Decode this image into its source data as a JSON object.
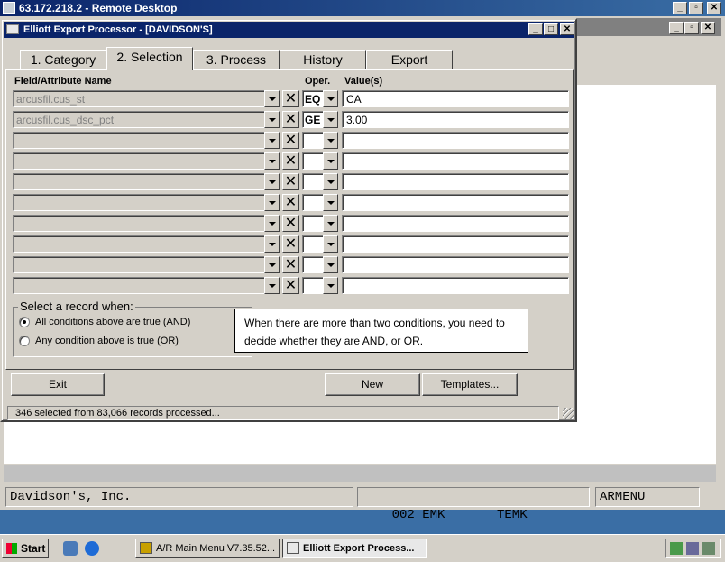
{
  "remote_desktop": {
    "title": "63.172.218.2 - Remote Desktop"
  },
  "dialog": {
    "title": "Elliott Export Processor - [DAVIDSON'S]",
    "tabs": [
      {
        "label": "1. Category"
      },
      {
        "label": "2. Selection"
      },
      {
        "label": "3. Process"
      },
      {
        "label": "History"
      },
      {
        "label": "Export"
      }
    ],
    "headers": {
      "field": "Field/Attribute Name",
      "oper": "Oper.",
      "value": "Value(s)"
    },
    "rows": [
      {
        "field": "arcusfil.cus_st",
        "oper": "EQ",
        "value": "CA"
      },
      {
        "field": "arcusfil.cus_dsc_pct",
        "oper": "GE",
        "value": "3.00"
      },
      {
        "field": "",
        "oper": "",
        "value": ""
      },
      {
        "field": "",
        "oper": "",
        "value": ""
      },
      {
        "field": "",
        "oper": "",
        "value": ""
      },
      {
        "field": "",
        "oper": "",
        "value": ""
      },
      {
        "field": "",
        "oper": "",
        "value": ""
      },
      {
        "field": "",
        "oper": "",
        "value": ""
      },
      {
        "field": "",
        "oper": "",
        "value": ""
      },
      {
        "field": "",
        "oper": "",
        "value": ""
      }
    ],
    "select_group": {
      "title": "Select a record when:",
      "and_label": "All conditions above are true (AND)",
      "or_label": "Any condition above is true (OR)",
      "selected": "and"
    },
    "tooltip": "When there are more than two conditions, you need to decide whether they are AND, or OR.",
    "buttons": {
      "exit": "Exit",
      "new": "New",
      "templates": "Templates..."
    },
    "status": "346 selected from 83,066 records processed..."
  },
  "background_app": {
    "status": {
      "company": "Davidson's, Inc.",
      "code": "002 EMK",
      "user": "TEMK",
      "menu": "ARMENU"
    }
  },
  "taskbar": {
    "start": "Start",
    "tasks": [
      {
        "label": "A/R Main Menu V7.35.52...",
        "active": false
      },
      {
        "label": "Elliott Export Process...",
        "active": true
      }
    ]
  },
  "colors": {
    "titlebar": "#0a246a",
    "desktop": "#3a6ea5",
    "face": "#d4d0c8"
  }
}
